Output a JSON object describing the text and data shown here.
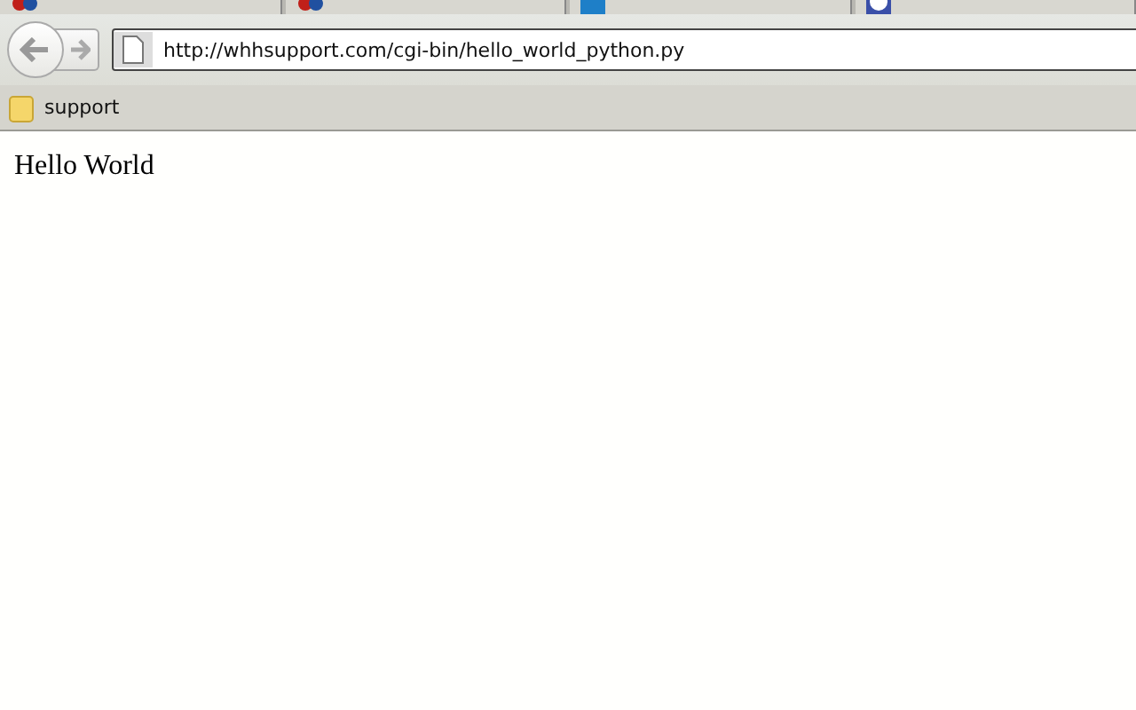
{
  "tabs": [
    {
      "kind": "logo"
    },
    {
      "kind": "logo"
    },
    {
      "kind": "square"
    },
    {
      "kind": "circle"
    }
  ],
  "address_bar": {
    "value": "http://whhsupport.com/cgi-bin/hello_world_python.py"
  },
  "bookmarks": [
    {
      "label": "support"
    }
  ],
  "page": {
    "text": "Hello World"
  }
}
